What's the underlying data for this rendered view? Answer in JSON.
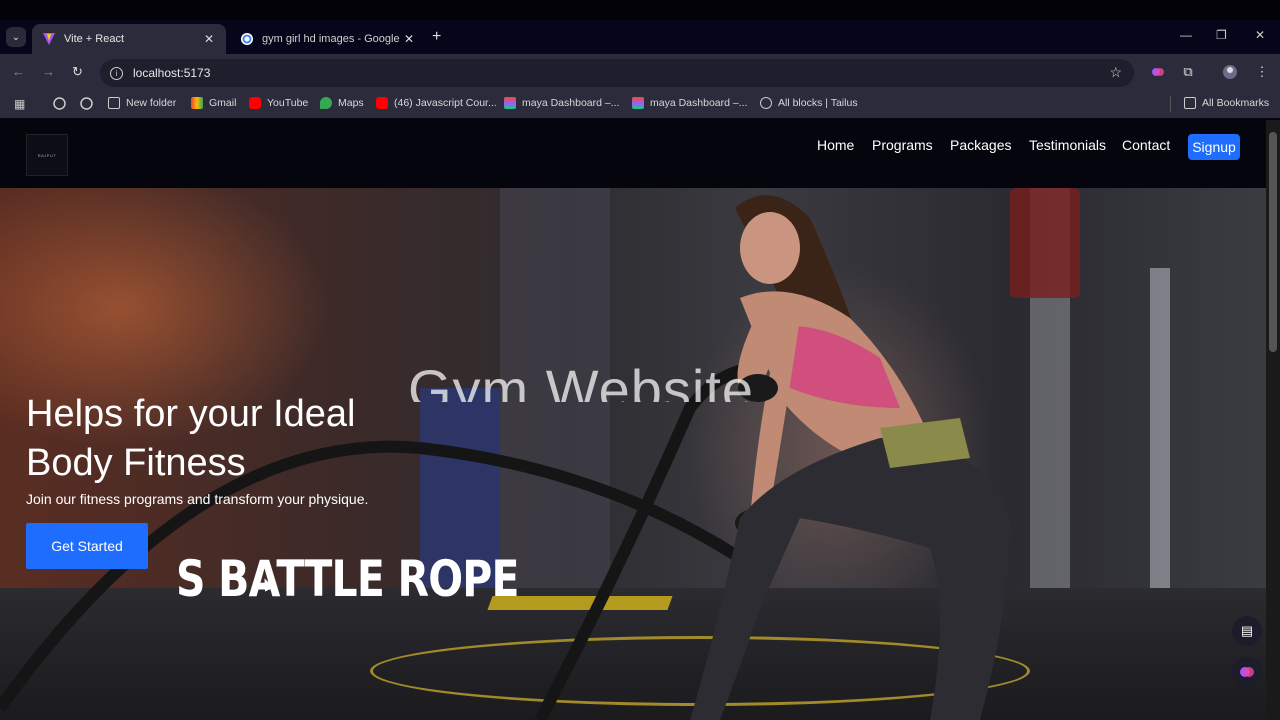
{
  "browser": {
    "tabs": [
      {
        "title": "Vite + React",
        "active": true
      },
      {
        "title": "gym girl hd images - Google Se",
        "active": false
      }
    ],
    "url": "localhost:5173",
    "bookmarks": [
      {
        "label": "New folder",
        "icon": "folder-icon"
      },
      {
        "label": "Gmail",
        "icon": "gmail-icon"
      },
      {
        "label": "YouTube",
        "icon": "youtube-icon"
      },
      {
        "label": "Maps",
        "icon": "maps-icon"
      },
      {
        "label": "(46) Javascript Cour...",
        "icon": "youtube-icon"
      },
      {
        "label": "maya Dashboard –...",
        "icon": "figma-icon"
      },
      {
        "label": "maya Dashboard –...",
        "icon": "figma-icon"
      },
      {
        "label": "All blocks | Tailus",
        "icon": "tailus-icon"
      }
    ],
    "all_bookmarks": "All Bookmarks"
  },
  "site": {
    "logo_text": "RAJPUT",
    "nav": [
      "Home",
      "Programs",
      "Packages",
      "Testimonials",
      "Contact"
    ],
    "signup": "Signup"
  },
  "hero": {
    "overlay_title": "Gym Website",
    "heading": "Helps for your Ideal Body Fitness",
    "subheading": "Join our fitness programs and transform your physique.",
    "cta": "Get Started",
    "banner": "S BATTLE ROPE"
  },
  "colors": {
    "accent": "#1f6dff",
    "nav_bg": "#05050e",
    "chrome_bg": "#2b2b3c"
  }
}
